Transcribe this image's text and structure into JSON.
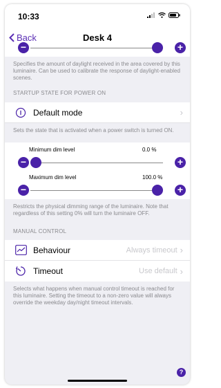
{
  "status_bar": {
    "time": "10:33"
  },
  "navbar": {
    "back_label": "Back",
    "title": "Desk 4"
  },
  "daylight": {
    "level": 1.0,
    "footnote": "Specifies the amount of daylight received in the area covered by this luminaire. Can be used to calibrate the response of daylight-enabled scenes."
  },
  "startup": {
    "header": "STARTUP STATE FOR POWER ON",
    "row_label": "Default mode",
    "footnote": "Sets the state that is activated when a power switch is turned ON."
  },
  "dimming": {
    "min_label": "Minimum dim level",
    "min_value": "0.0 %",
    "min_level": 0.0,
    "max_label": "Maximum dim level",
    "max_value": "100.0 %",
    "max_level": 1.0,
    "footnote": "Restricts the physical dimming range of the luminaire. Note that regardless of this setting 0% will turn the luminaire OFF."
  },
  "manual_control": {
    "header": "MANUAL CONTROL",
    "behaviour_label": "Behaviour",
    "behaviour_value": "Always timeout",
    "timeout_label": "Timeout",
    "timeout_value": "Use default",
    "footnote": "Selects what happens when manual control timeout is reached for this luminaire. Setting the timeout to a non-zero value will always override the weekday day/night timeout intervals."
  },
  "help_label": "?",
  "colors": {
    "accent": "#4a22a8",
    "link": "#5b2fb5",
    "background": "#efeff4",
    "secondary_text": "#8a8a8e"
  }
}
